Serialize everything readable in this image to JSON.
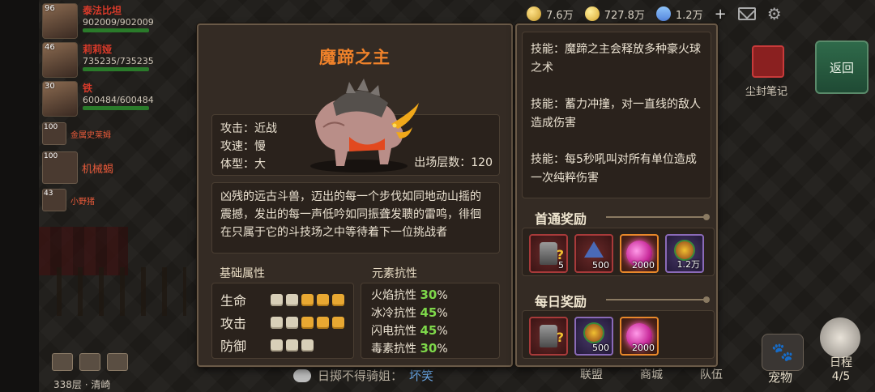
{
  "party": {
    "members": [
      {
        "level": "96",
        "name": "泰法比坦",
        "hp": "902009/902009"
      },
      {
        "level": "46",
        "name": "莉莉娅",
        "hp": "735235/735235"
      },
      {
        "level": "30",
        "name": "铁",
        "hp": "600484/600484"
      }
    ],
    "minions": [
      {
        "level": "100",
        "name": "金属史莱姆"
      },
      {
        "level": "100",
        "name": "机械蝎"
      },
      {
        "level": "43",
        "name": "小野猪"
      }
    ]
  },
  "topbar": {
    "gold": "7.6万",
    "coins": "727.8万",
    "gems": "1.2万",
    "plus": "+"
  },
  "side": {
    "book_label": "尘封笔记",
    "return_label": "返回",
    "pet_label": "宠物",
    "schedule_label": "日程",
    "schedule_count": "4/5"
  },
  "bottom_nav": [
    "联盟",
    "商城",
    "队伍"
  ],
  "chat": {
    "prefix": "日掷不得骑姐：",
    "highlight": "坏笑"
  },
  "floor_info": "338层 · 清崎",
  "boss": {
    "name": "魔蹄之主",
    "attack_type": "攻击：近战",
    "attack_speed": "攻速：慢",
    "body_size": "体型：大",
    "floor_count": "出场层数：120",
    "description": "凶残的远古斗兽，迈出的每一个步伐如同地动山摇的震撼，发出的每一声低吟如同振聋发聩的雷鸣，徘徊在只属于它的斗技场之中等待着下一位挑战者"
  },
  "attributes": {
    "label": "基础属性",
    "rows": [
      {
        "label": "生命",
        "filled": 3,
        "total": 5
      },
      {
        "label": "攻击",
        "filled": 3,
        "total": 5
      },
      {
        "label": "防御",
        "filled": 0,
        "total": 3
      }
    ]
  },
  "resistance": {
    "label": "元素抗性",
    "rows": [
      {
        "label": "火焰抗性",
        "value": "30",
        "unit": "%"
      },
      {
        "label": "冰冷抗性",
        "value": "45",
        "unit": "%"
      },
      {
        "label": "闪电抗性",
        "value": "45",
        "unit": "%"
      },
      {
        "label": "毒素抗性",
        "value": "30",
        "unit": "%"
      }
    ]
  },
  "skills": [
    "技能：魔蹄之主会释放多种豪火球之术",
    "技能：蓄力冲撞，对一直线的敌人造成伤害",
    "技能：每5秒吼叫对所有单位造成一次纯粹伤害"
  ],
  "first_reward": {
    "label": "首通奖励",
    "items": [
      {
        "icon": "stone-box-icon",
        "qty": "5",
        "frame": "red"
      },
      {
        "icon": "crystal-icon",
        "qty": "500",
        "frame": "red"
      },
      {
        "icon": "orb-icon",
        "qty": "2000",
        "frame": "orange"
      },
      {
        "icon": "seal-icon",
        "qty": "1.2万",
        "frame": "purple"
      }
    ]
  },
  "daily_reward": {
    "label": "每日奖励",
    "items": [
      {
        "icon": "stone-box-icon",
        "qty": "",
        "frame": "red"
      },
      {
        "icon": "seal-icon",
        "qty": "500",
        "frame": "purple"
      },
      {
        "icon": "orb-icon",
        "qty": "2000",
        "frame": "orange"
      }
    ]
  }
}
